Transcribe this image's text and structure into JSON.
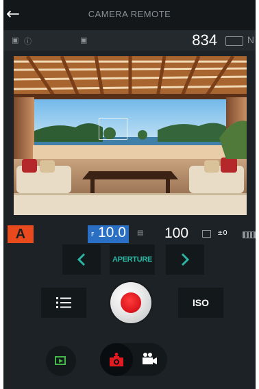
{
  "header": {
    "title": "CAMERA REMOTE",
    "back_icon": "back-arrow-icon"
  },
  "status": {
    "shots_remaining": "834",
    "icons": [
      "image-size-icon",
      "quality-icon",
      "camera-mode-icon",
      "sd-card-icon"
    ],
    "trailing": "N"
  },
  "exposure": {
    "mode": "A",
    "aperture_prefix": "F",
    "aperture_value": "10.0",
    "iso_value": "100",
    "exposure_comp": "±0"
  },
  "controls": {
    "aperture_label": "APERTURE",
    "iso_button_label": "ISO"
  },
  "colors": {
    "mode_badge": "#e8491d",
    "aperture_highlight": "#2a6fc4",
    "aperture_label": "#2cb5a4",
    "shutter": "#d9141c",
    "playback": "#44b649"
  }
}
